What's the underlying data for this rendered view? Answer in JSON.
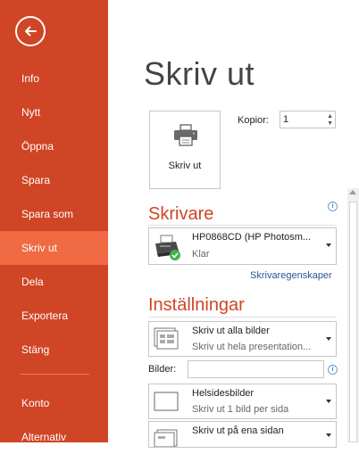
{
  "sidebar": {
    "items": [
      {
        "label": "Info"
      },
      {
        "label": "Nytt"
      },
      {
        "label": "Öppna"
      },
      {
        "label": "Spara"
      },
      {
        "label": "Spara som"
      },
      {
        "label": "Skriv ut",
        "active": true
      },
      {
        "label": "Dela"
      },
      {
        "label": "Exportera"
      },
      {
        "label": "Stäng"
      },
      {
        "label": "Konto"
      },
      {
        "label": "Alternativ"
      }
    ]
  },
  "main": {
    "title": "Skriv ut",
    "print_button_label": "Skriv ut",
    "copies_label": "Kopior:",
    "copies_value": "1",
    "printer_section": "Skrivare",
    "printer_name": "HP0868CD (HP Photosm...",
    "printer_status": "Klar",
    "printer_properties_link": "Skrivaregenskaper",
    "settings_section": "Inställningar",
    "setting1_main": "Skriv ut alla bilder",
    "setting1_sub": "Skriv ut hela presentation...",
    "slides_label": "Bilder:",
    "slides_value": "",
    "setting2_main": "Helsidesbilder",
    "setting2_sub": "Skriv ut 1 bild per sida",
    "setting3_main": "Skriv ut på ena sidan"
  },
  "colors": {
    "sidebar_bg": "#D04525",
    "active_bg": "#F06A43",
    "accent": "#D04525"
  }
}
